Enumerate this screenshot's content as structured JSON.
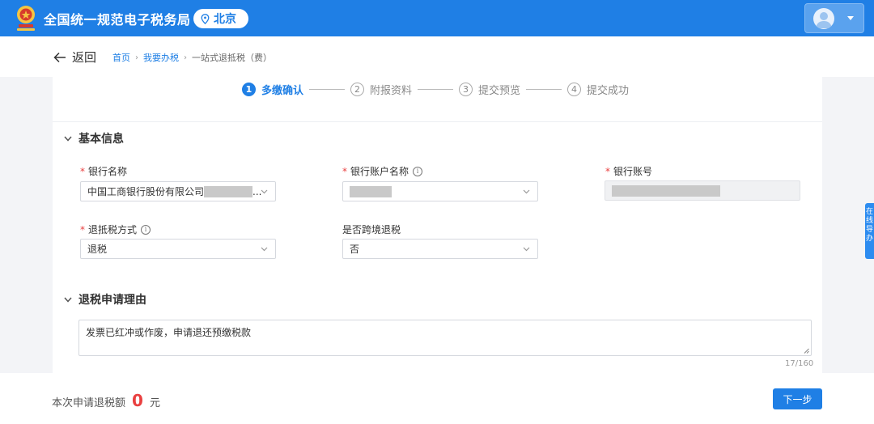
{
  "header": {
    "app_title": "全国统一规范电子税务局",
    "city": "北京",
    "emblem_icon": "tax-emblem-icon",
    "user_icon": "user-avatar-icon"
  },
  "nav": {
    "back_label": "返回",
    "breadcrumb": [
      "首页",
      "我要办税",
      "一站式退抵税（费）"
    ]
  },
  "steps": [
    {
      "num": "1",
      "label": "多缴确认",
      "active": true
    },
    {
      "num": "2",
      "label": "附报资料",
      "active": false
    },
    {
      "num": "3",
      "label": "提交预览",
      "active": false
    },
    {
      "num": "4",
      "label": "提交成功",
      "active": false
    }
  ],
  "basic_info": {
    "title": "基本信息",
    "bank_name": {
      "label": "银行名称",
      "value": "中国工商银行股份有限公司",
      "suffix": "..."
    },
    "account_name": {
      "label": "银行账户名称",
      "value": ""
    },
    "account_no": {
      "label": "银行账号",
      "value": ""
    },
    "refund_method": {
      "label": "退抵税方式",
      "value": "退税"
    },
    "cross_border": {
      "label": "是否跨境退税",
      "value": "否"
    }
  },
  "reason": {
    "title": "退税申请理由",
    "text": "发票已红冲或作废，申请退还预缴税款",
    "counter": "17/160"
  },
  "side_tab": {
    "text": "在线导办"
  },
  "footer": {
    "amount_label": "本次申请退税额",
    "amount_value": "0",
    "amount_unit": "元",
    "next_label": "下一步"
  },
  "colors": {
    "brand": "#1f7fe5",
    "required": "#e94040",
    "amount": "#e94040"
  }
}
